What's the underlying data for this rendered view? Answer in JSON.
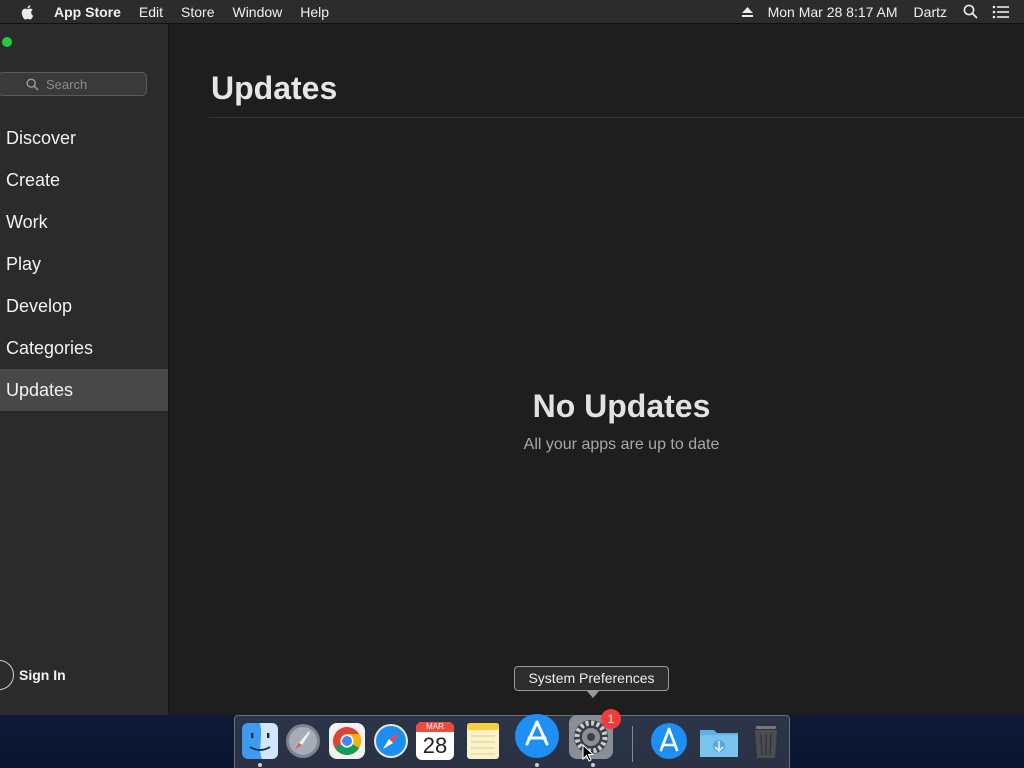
{
  "menubar": {
    "app_name": "App Store",
    "menus": [
      "Edit",
      "Store",
      "Window",
      "Help"
    ],
    "clock": "Mon Mar 28  8:17 AM",
    "user": "Dartz"
  },
  "sidebar": {
    "search_placeholder": "Search",
    "items": [
      {
        "label": "Discover"
      },
      {
        "label": "Create"
      },
      {
        "label": "Work"
      },
      {
        "label": "Play"
      },
      {
        "label": "Develop"
      },
      {
        "label": "Categories"
      },
      {
        "label": "Updates",
        "selected": true
      }
    ],
    "sign_in_label": "Sign In"
  },
  "main": {
    "title": "Updates",
    "empty_title": "No Updates",
    "empty_subtitle": "All your apps are up to date"
  },
  "tooltip": {
    "text": "System Preferences"
  },
  "dock": {
    "apps": [
      {
        "name": "finder-icon",
        "running": true
      },
      {
        "name": "launchpad-icon",
        "running": false
      },
      {
        "name": "chrome-icon",
        "running": false
      },
      {
        "name": "safari-icon",
        "running": false
      },
      {
        "name": "calendar-icon",
        "running": false,
        "month": "MAR",
        "day": "28"
      },
      {
        "name": "notes-icon",
        "running": false
      },
      {
        "name": "app-store-icon",
        "running": true
      },
      {
        "name": "system-preferences-icon",
        "running": true,
        "badge": "1"
      },
      {
        "name": "app-store-download-icon",
        "running": false
      },
      {
        "name": "downloads-folder-icon",
        "running": false
      },
      {
        "name": "trash-icon",
        "running": false
      }
    ]
  },
  "colors": {
    "window_bg": "#1e1e1e",
    "sidebar_bg": "#2b2b2b",
    "selected_bg": "#484848",
    "badge_red": "#f23b3b",
    "traffic_green": "#27c93f"
  }
}
